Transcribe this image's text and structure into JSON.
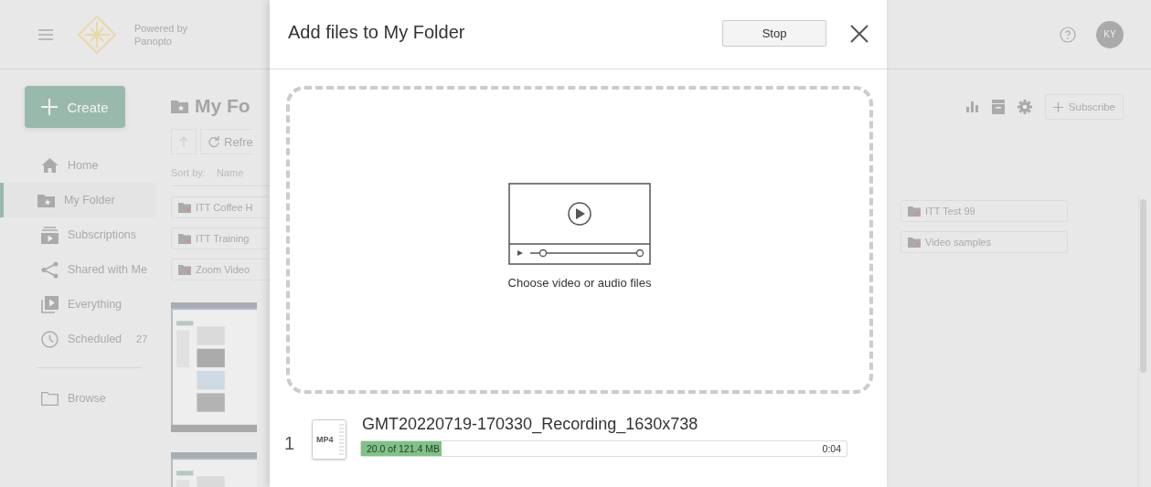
{
  "header": {
    "brand_line_1": "Powered by",
    "brand_line_2": "Panopto",
    "avatar": "KY"
  },
  "sidebar": {
    "create": "Create",
    "items": [
      {
        "kind": "home",
        "label": "Home",
        "selected": false
      },
      {
        "kind": "folder",
        "label": "My Folder",
        "selected": true
      },
      {
        "kind": "subscriptions",
        "label": "Subscriptions",
        "selected": false
      },
      {
        "kind": "shared",
        "label": "Shared with Me",
        "selected": false
      },
      {
        "kind": "everything",
        "label": "Everything",
        "selected": false
      },
      {
        "kind": "scheduled",
        "label": "Scheduled",
        "count": "27",
        "selected": false
      }
    ],
    "browse": "Browse"
  },
  "folder_view": {
    "title": "My Fo",
    "refresh": "Refre",
    "sort_label": "Sort by:",
    "sort_value": "Name",
    "folders_left": [
      "ITT Coffee H",
      "ITT Training",
      "Zoom Video"
    ],
    "subscribe": "Subscribe",
    "folders_right": [
      "ITT Test 99",
      "Video samples"
    ],
    "thumbnails": [
      {
        "kind": "picture"
      },
      {
        "kind": "picture"
      }
    ]
  },
  "dialog": {
    "title": "Add files to My Folder",
    "stop": "Stop",
    "dropzone": "Choose video or audio files",
    "uploads": [
      {
        "index": "1",
        "type": "MP4",
        "name": "GMT20220719-170330_Recording_1630x738",
        "progress": "20.0 of 121.4 MB",
        "level": 0.165,
        "time": "0:04"
      }
    ]
  }
}
